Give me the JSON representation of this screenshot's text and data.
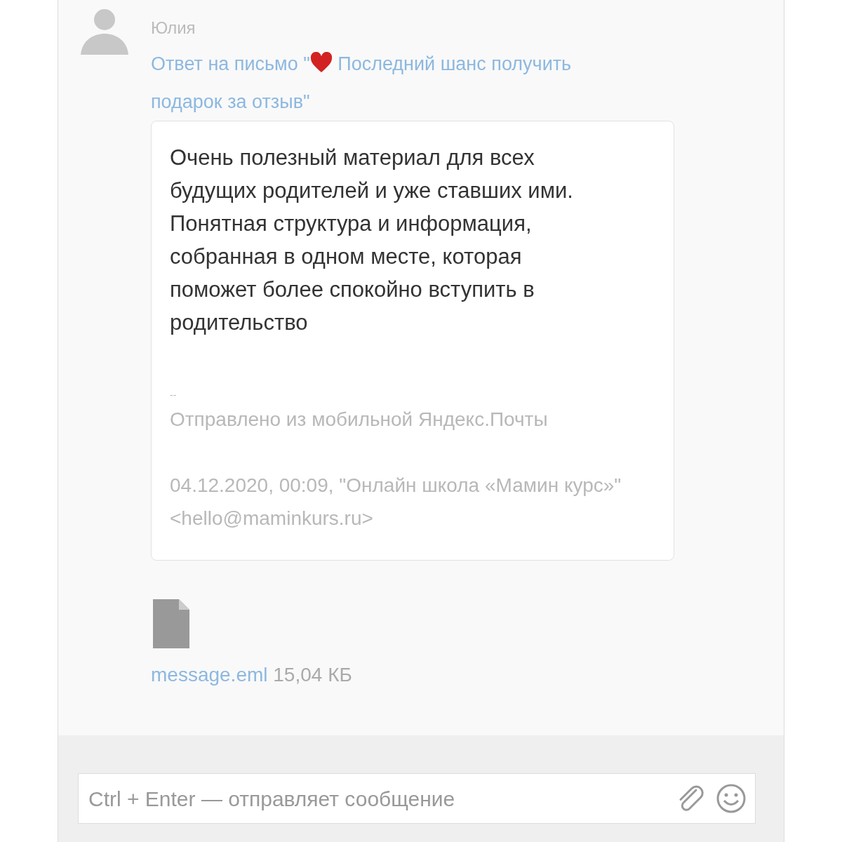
{
  "message": {
    "author": "Юлия",
    "subject": [
      {
        "kind": "text",
        "text": "Ответ на письмо \""
      },
      {
        "kind": "heart"
      },
      {
        "kind": "text",
        "text": " Последний шанс получить подарок за отзыв\""
      }
    ],
    "body": "Очень полезный материал для всех будущих родителей и уже ставших ими. Понятная структура и информация, собранная в одном месте, которая поможет более спокойно вступить в родительство",
    "signature": "--",
    "sent_from": "Отправлено из мобильной Яндекс.Почты",
    "quote_header": "04.12.2020, 00:09, \"Онлайн школа «Мамин курс»\" <hello@maminkurs.ru>"
  },
  "attachment": {
    "name": "message.eml",
    "size": "15,04 КБ"
  },
  "composer": {
    "placeholder": "Ctrl + Enter — отправляет сообщение"
  }
}
